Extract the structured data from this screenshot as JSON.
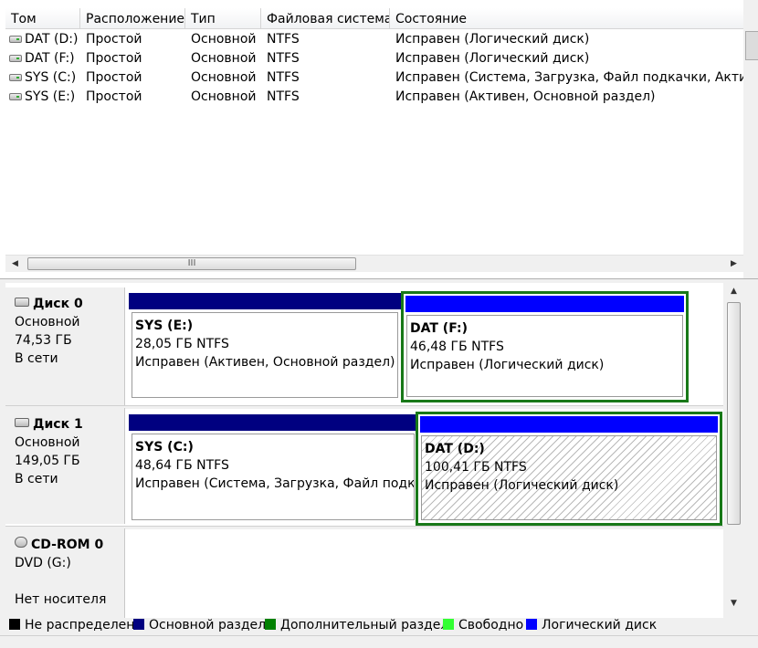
{
  "columns": [
    "Том",
    "Расположение",
    "Тип",
    "Файловая система",
    "Состояние"
  ],
  "volumes": [
    {
      "name": "DAT (D:)",
      "layout": "Простой",
      "type": "Основной",
      "fs": "NTFS",
      "status": "Исправен (Логический диск)"
    },
    {
      "name": "DAT (F:)",
      "layout": "Простой",
      "type": "Основной",
      "fs": "NTFS",
      "status": "Исправен (Логический диск)"
    },
    {
      "name": "SYS (C:)",
      "layout": "Простой",
      "type": "Основной",
      "fs": "NTFS",
      "status": "Исправен (Система, Загрузка, Файл подкачки, Активен,"
    },
    {
      "name": "SYS (E:)",
      "layout": "Простой",
      "type": "Основной",
      "fs": "NTFS",
      "status": "Исправен (Активен, Основной раздел)"
    }
  ],
  "hscroll_thumb_grip": "III",
  "disks": [
    {
      "title": "Диск 0",
      "kind": "Основной",
      "size": "74,53 ГБ",
      "state": "В сети",
      "partitions": [
        {
          "name": "SYS  (E:)",
          "size": "28,05 ГБ NTFS",
          "status": "Исправен (Активен, Основной раздел)"
        },
        {
          "name": "DAT  (F:)",
          "size": "46,48 ГБ NTFS",
          "status": "Исправен (Логический диск)"
        }
      ]
    },
    {
      "title": "Диск 1",
      "kind": "Основной",
      "size": "149,05 ГБ",
      "state": "В сети",
      "partitions": [
        {
          "name": "SYS  (C:)",
          "size": "48,64 ГБ NTFS",
          "status": "Исправен (Система, Загрузка, Файл подкач"
        },
        {
          "name": "DAT  (D:)",
          "size": "100,41 ГБ NTFS",
          "status": "Исправен (Логический диск)"
        }
      ]
    }
  ],
  "cdrom": {
    "title": "CD-ROM 0",
    "drive": "DVD (G:)",
    "media": "Нет носителя"
  },
  "legend": [
    {
      "label": "Не распределен",
      "color": "#000000"
    },
    {
      "label": "Основной раздел",
      "color": "#000080"
    },
    {
      "label": "Дополнительный раздел",
      "color": "#008000"
    },
    {
      "label": "Свободно",
      "color": "#33ff33"
    },
    {
      "label": "Логический диск",
      "color": "#0000ff"
    }
  ],
  "colors": {
    "primary": "#000080",
    "logical": "#0000ff",
    "extended_border": "#187818"
  }
}
